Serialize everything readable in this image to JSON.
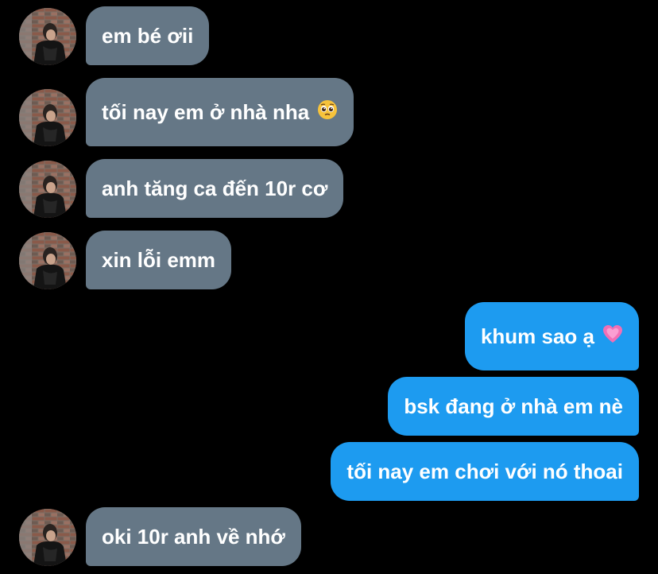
{
  "conversation": {
    "colors": {
      "background": "#000000",
      "incoming_bubble": "#657786",
      "outgoing_bubble": "#1d9bf0",
      "text": "#ffffff"
    },
    "messages": [
      {
        "direction": "incoming",
        "text": "em bé ơii"
      },
      {
        "direction": "incoming",
        "text": "tối nay em ở nhà nha",
        "emoji": "pleading-face"
      },
      {
        "direction": "incoming",
        "text": "anh tăng ca đến 10r cơ"
      },
      {
        "direction": "incoming",
        "text": "xin lỗi emm"
      },
      {
        "direction": "outgoing",
        "text": "khum sao ạ",
        "emoji": "growing-heart"
      },
      {
        "direction": "outgoing",
        "text": "bsk đang ở nhà em nè"
      },
      {
        "direction": "outgoing",
        "text": "tối nay em chơi với nó thoai"
      },
      {
        "direction": "incoming",
        "text": "oki 10r anh về nhớ"
      }
    ]
  }
}
